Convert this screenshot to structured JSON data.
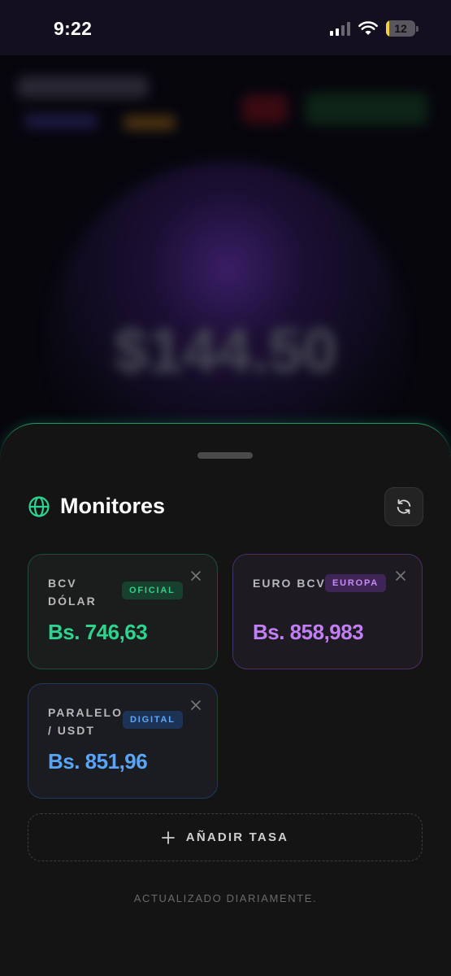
{
  "status_bar": {
    "time": "9:22",
    "battery_level": "12",
    "battery_fraction": 0.12
  },
  "background": {
    "amount": "$144.50"
  },
  "sheet": {
    "title": "Monitores",
    "cards": [
      {
        "label": "BCV DÓLAR",
        "badge": "OFICIAL",
        "value": "Bs. 746,63",
        "color": "#2fd390"
      },
      {
        "label": "EURO BCV",
        "badge": "EUROPA",
        "value": "Bs. 858,983",
        "color": "#c27ef5"
      },
      {
        "label": "PARALELO / USDT",
        "badge": "DIGITAL",
        "value": "Bs. 851,96",
        "color": "#5aa4f7"
      }
    ],
    "add_label": "AÑADIR TASA",
    "footer": "ACTUALIZADO DIARIAMENTE."
  },
  "colors": {
    "accent_green": "#2fd390",
    "accent_purple": "#c27ef5",
    "accent_blue": "#5aa4f7",
    "sheet_bg": "#141414"
  },
  "icons": {
    "header": "globe-icon",
    "refresh": "refresh-icon",
    "close": "close-icon",
    "add": "plus-icon",
    "signal": "cellular-signal-icon",
    "wifi": "wifi-icon",
    "battery": "battery-icon"
  }
}
